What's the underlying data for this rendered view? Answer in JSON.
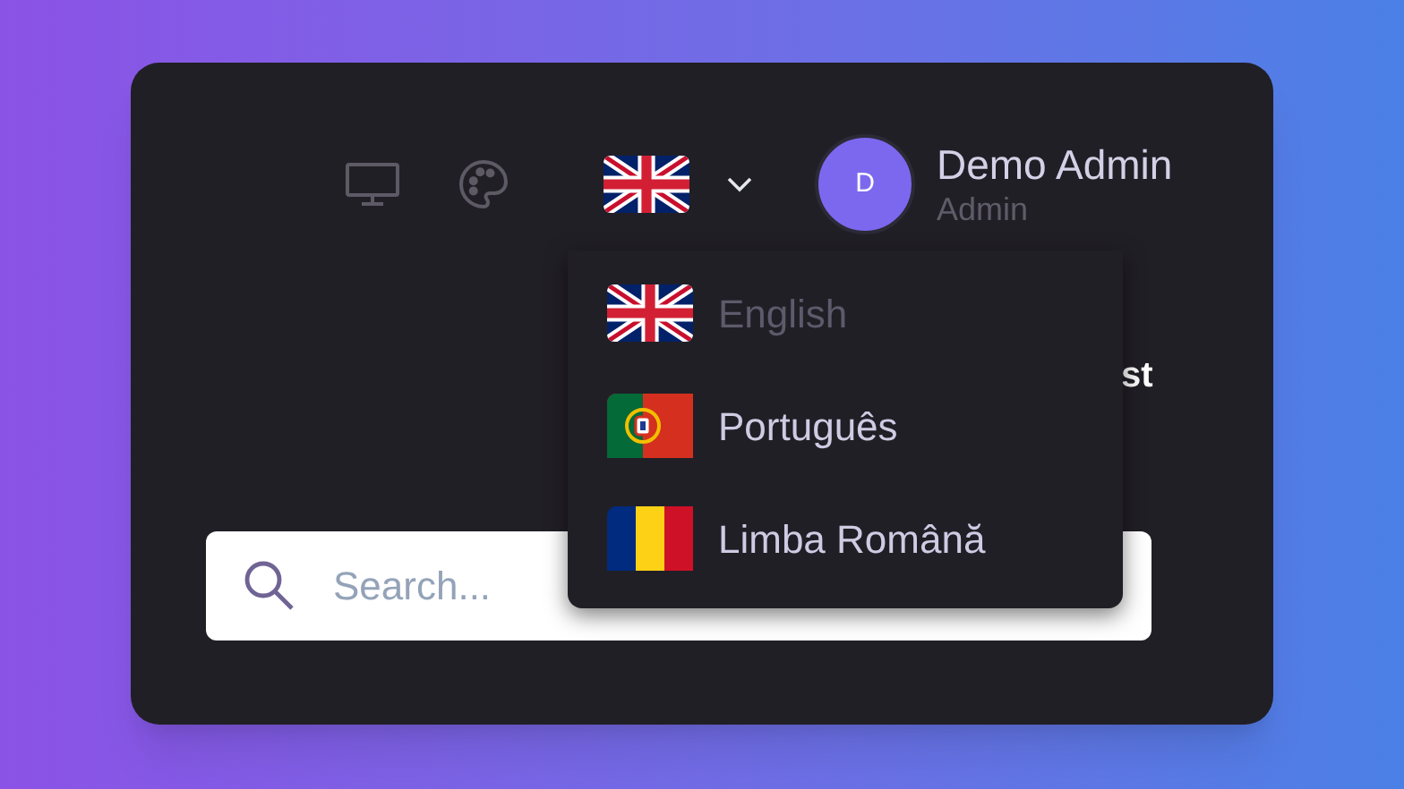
{
  "header": {
    "language_button": {
      "kind": "uk"
    },
    "user": {
      "initial": "D",
      "name": "Demo Admin",
      "role": "Admin"
    }
  },
  "hidden_heading": "st",
  "language_menu": [
    {
      "kind": "uk",
      "label": "English",
      "selected": true
    },
    {
      "kind": "pt",
      "label": "Português",
      "selected": false
    },
    {
      "kind": "ro",
      "label": "Limba Română",
      "selected": false
    }
  ],
  "search": {
    "placeholder": "Search..."
  }
}
